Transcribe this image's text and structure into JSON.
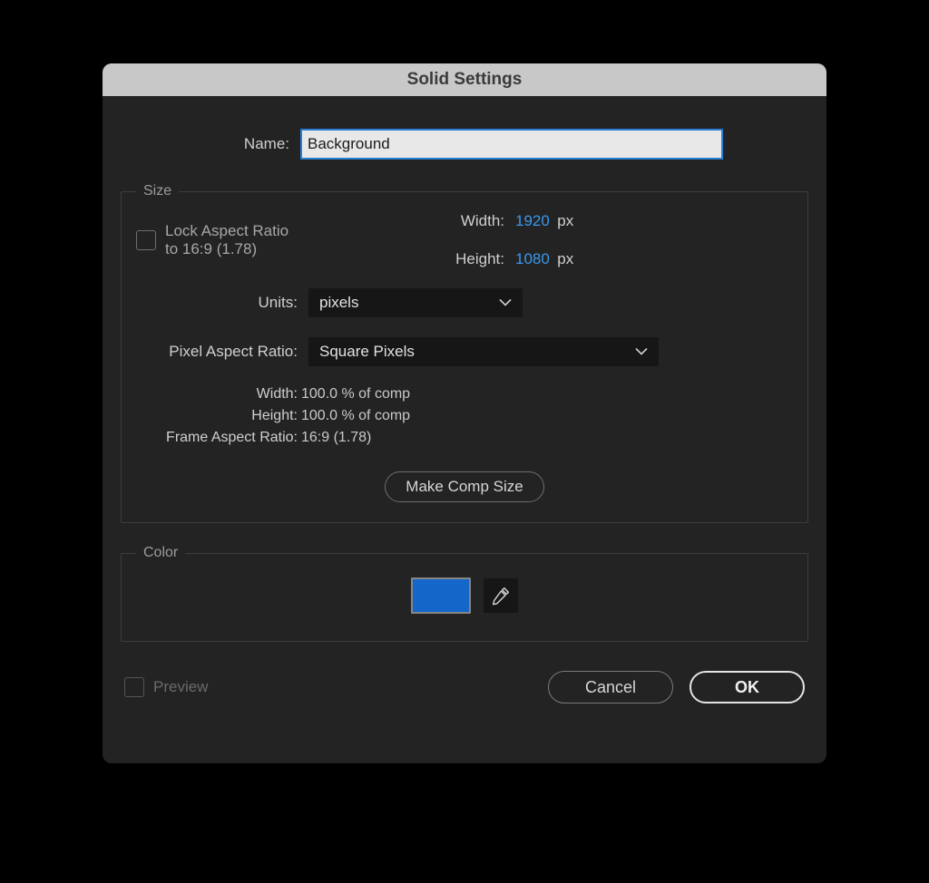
{
  "dialog": {
    "title": "Solid Settings",
    "name_label": "Name:",
    "name_value": "Background"
  },
  "size": {
    "group_label": "Size",
    "width_label": "Width:",
    "width_value": "1920",
    "height_label": "Height:",
    "height_value": "1080",
    "px_unit": "px",
    "lock_label": "Lock Aspect Ratio to 16:9 (1.78)",
    "units_label": "Units:",
    "units_value": "pixels",
    "par_label": "Pixel Aspect Ratio:",
    "par_value": "Square Pixels",
    "info_width_label": "Width:",
    "info_width_value": "100.0 % of comp",
    "info_height_label": "Height:",
    "info_height_value": "100.0 % of comp",
    "far_label": "Frame Aspect Ratio:",
    "far_value": "16:9 (1.78)",
    "make_comp_label": "Make Comp Size"
  },
  "color": {
    "group_label": "Color",
    "swatch_hex": "#1466c9"
  },
  "footer": {
    "preview_label": "Preview",
    "cancel_label": "Cancel",
    "ok_label": "OK"
  }
}
